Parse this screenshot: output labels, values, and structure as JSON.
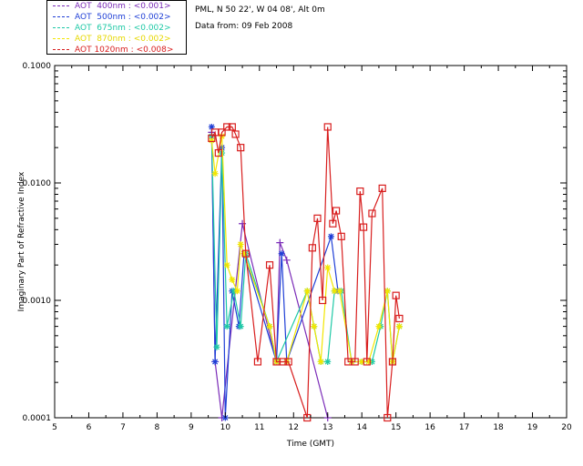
{
  "info": {
    "site": "PML, N 50 22', W 04 08', Alt 0m",
    "data_from": "Data from: 09 Feb 2008"
  },
  "legend": [
    {
      "label": "AOT  400nm : <0.001>",
      "color": "#7b2cb8"
    },
    {
      "label": "AOT  500nm : <0.002>",
      "color": "#1f3fd6"
    },
    {
      "label": "AOT  675nm : <0.002>",
      "color": "#1ec9a6"
    },
    {
      "label": "AOT  870nm : <0.002>",
      "color": "#f2e600"
    },
    {
      "label": "AOT 1020nm : <0.008>",
      "color": "#d81e1e"
    }
  ],
  "chart_data": {
    "type": "line",
    "xlabel": "Time (GMT)",
    "ylabel": "Imaginary Part of Refractive Index",
    "xlim": [
      5,
      20
    ],
    "ylim": [
      0.0001,
      0.1
    ],
    "yscale": "log",
    "x_ticks": [
      "5",
      "6",
      "7",
      "8",
      "9",
      "10",
      "11",
      "12",
      "13",
      "14",
      "15",
      "16",
      "17",
      "18",
      "19",
      "20"
    ],
    "y_ticks": [
      "0.0001",
      "0.0010",
      "0.0100",
      "0.1000"
    ],
    "grid": false,
    "series": [
      {
        "name": "AOT  400nm : <0.001>",
        "color": "#7b2cb8",
        "marker": "plus",
        "x": [
          9.6,
          9.7,
          9.9,
          10.5,
          11.5,
          11.6,
          11.8,
          13.0
        ],
        "y": [
          0.027,
          0.0003,
          0.0001,
          0.0045,
          0.0003,
          0.0031,
          0.0022,
          0.0001
        ]
      },
      {
        "name": "AOT  500nm : <0.002>",
        "color": "#1f3fd6",
        "marker": "star",
        "x": [
          9.6,
          9.7,
          9.9,
          10.0,
          10.2,
          10.4,
          10.55,
          11.5,
          11.65,
          11.8,
          13.1,
          13.3
        ],
        "y": [
          0.03,
          0.0003,
          0.02,
          0.0001,
          0.0012,
          0.0006,
          0.0025,
          0.0003,
          0.0025,
          0.0003,
          0.0035,
          0.0012
        ]
      },
      {
        "name": "AOT  675nm : <0.002>",
        "color": "#1ec9a6",
        "marker": "star",
        "x": [
          9.6,
          9.75,
          9.9,
          10.05,
          10.25,
          10.45,
          10.6,
          11.3,
          11.5,
          12.4,
          12.6,
          12.8,
          13.0,
          13.2,
          13.4,
          13.7,
          14.0,
          14.3,
          14.55,
          14.75,
          14.9,
          15.1
        ],
        "y": [
          0.025,
          0.0004,
          0.018,
          0.0006,
          0.0012,
          0.0006,
          0.0025,
          0.0006,
          0.0003,
          0.0012,
          0.0006,
          0.0003,
          0.0003,
          0.0012,
          0.0012,
          0.0003,
          0.0003,
          0.0003,
          0.0006,
          0.0012,
          0.0003,
          0.0006
        ]
      },
      {
        "name": "AOT  870nm : <0.002>",
        "color": "#f2e600",
        "marker": "star",
        "x": [
          9.6,
          9.7,
          9.9,
          10.05,
          10.2,
          10.35,
          10.45,
          10.55,
          11.3,
          11.5,
          11.8,
          12.4,
          12.6,
          12.8,
          13.0,
          13.2,
          13.35,
          13.7,
          14.0,
          14.2,
          14.5,
          14.75,
          14.9,
          15.1
        ],
        "y": [
          0.023,
          0.012,
          0.025,
          0.002,
          0.0015,
          0.0012,
          0.003,
          0.0025,
          0.0006,
          0.0003,
          0.0003,
          0.0012,
          0.0006,
          0.0003,
          0.0019,
          0.0012,
          0.0012,
          0.0003,
          0.0003,
          0.0003,
          0.0006,
          0.0012,
          0.0003,
          0.0006
        ]
      },
      {
        "name": "AOT 1020nm : <0.008>",
        "color": "#d81e1e",
        "marker": "square",
        "x": [
          9.6,
          9.7,
          9.8,
          9.9,
          10.05,
          10.2,
          10.3,
          10.45,
          10.6,
          10.95,
          11.3,
          11.5,
          11.7,
          11.85,
          12.4,
          12.55,
          12.7,
          12.85,
          13.0,
          13.15,
          13.25,
          13.4,
          13.6,
          13.8,
          13.95,
          14.05,
          14.15,
          14.3,
          14.6,
          14.75,
          14.9,
          15.0,
          15.1
        ],
        "y": [
          0.024,
          0.027,
          0.018,
          0.027,
          0.03,
          0.03,
          0.026,
          0.02,
          0.0025,
          0.0003,
          0.002,
          0.0003,
          0.0003,
          0.0003,
          0.0001,
          0.0028,
          0.005,
          0.001,
          0.03,
          0.0045,
          0.0058,
          0.0035,
          0.0003,
          0.0003,
          0.0085,
          0.0042,
          0.0003,
          0.0055,
          0.009,
          0.0001,
          0.0003,
          0.0011,
          0.0007
        ]
      }
    ]
  }
}
